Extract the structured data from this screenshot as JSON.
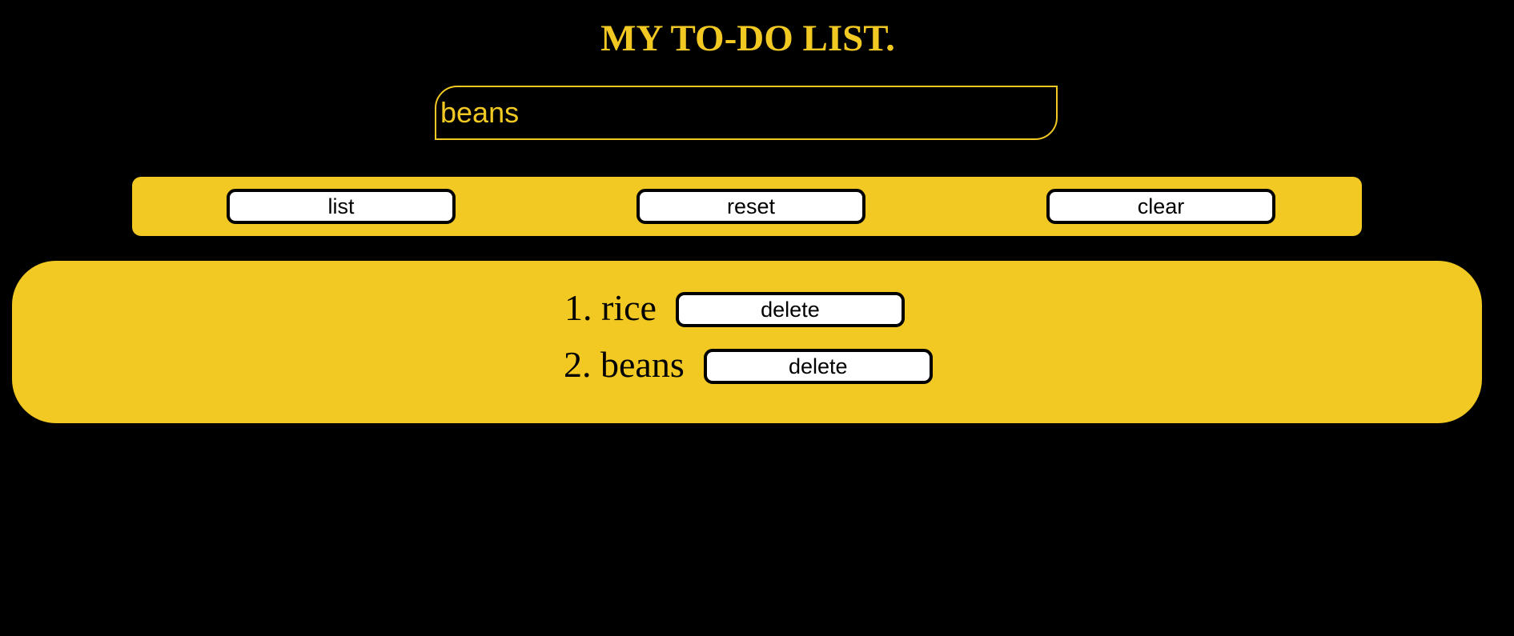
{
  "header": {
    "title": "MY TO-DO LIST."
  },
  "input": {
    "value": "beans"
  },
  "toolbar": {
    "list_label": "list",
    "reset_label": "reset",
    "clear_label": "clear"
  },
  "todos": {
    "items": [
      {
        "text": "1. rice",
        "delete_label": "delete"
      },
      {
        "text": "2. beans",
        "delete_label": "delete"
      }
    ]
  },
  "colors": {
    "background": "#000000",
    "accent": "#f2c922",
    "button_bg": "#ffffff",
    "button_border": "#000000"
  }
}
